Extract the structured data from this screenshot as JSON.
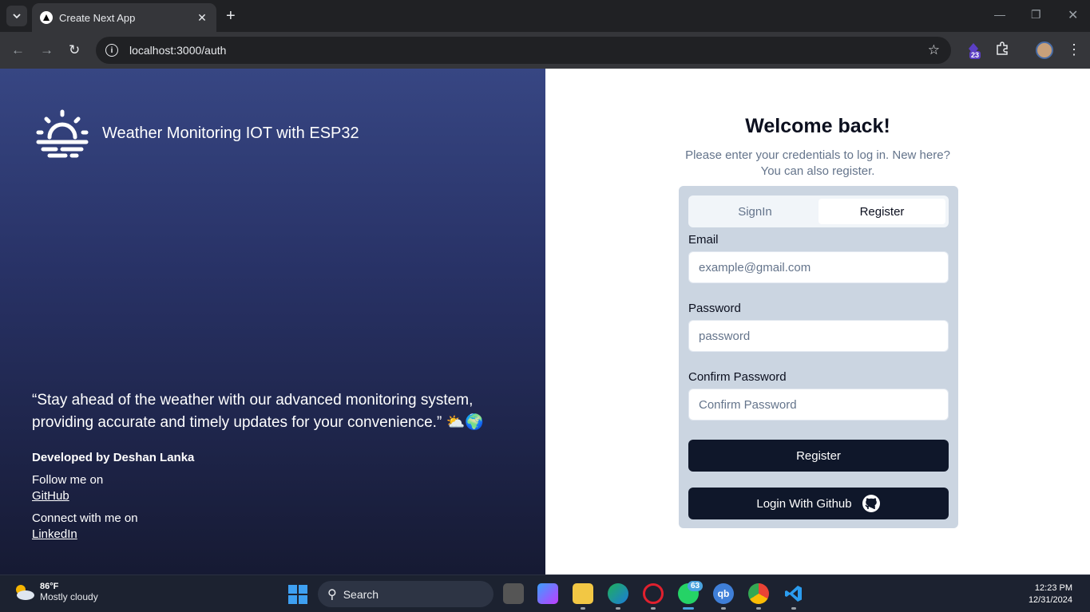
{
  "browser": {
    "tab_title": "Create Next App",
    "url": "localhost:3000/auth",
    "extension_badge": "23"
  },
  "brand": {
    "title": "Weather Monitoring IOT with ESP32"
  },
  "hero": {
    "quote": "“Stay ahead of the weather with our advanced monitoring system, providing accurate and timely updates for your convenience.” ⛅🌍",
    "developer": "Developed by Deshan Lanka",
    "follow_text": "Follow me on",
    "github_link": "GitHub",
    "connect_text": "Connect with me on",
    "linkedin_link": "LinkedIn"
  },
  "auth": {
    "heading": "Welcome back!",
    "subtitle": "Please enter your credentials to log in. New here? You can also register.",
    "tabs": [
      {
        "label": "SignIn",
        "active": false
      },
      {
        "label": "Register",
        "active": true
      }
    ],
    "email_label": "Email",
    "email_placeholder": "example@gmail.com",
    "password_label": "Password",
    "password_placeholder": "password",
    "confirm_label": "Confirm Password",
    "confirm_placeholder": "Confirm Password",
    "submit_label": "Register",
    "github_button_label": "Login With Github"
  },
  "taskbar": {
    "temperature": "86°F",
    "condition": "Mostly cloudy",
    "search_label": "Search",
    "whatsapp_badge": "63",
    "time": "12:23 PM",
    "date": "12/31/2024"
  },
  "colors": {
    "primary_button": "#0f172a",
    "card_bg": "#cbd5e1",
    "left_gradient_top": "#374683",
    "left_gradient_bottom": "#161a33"
  }
}
